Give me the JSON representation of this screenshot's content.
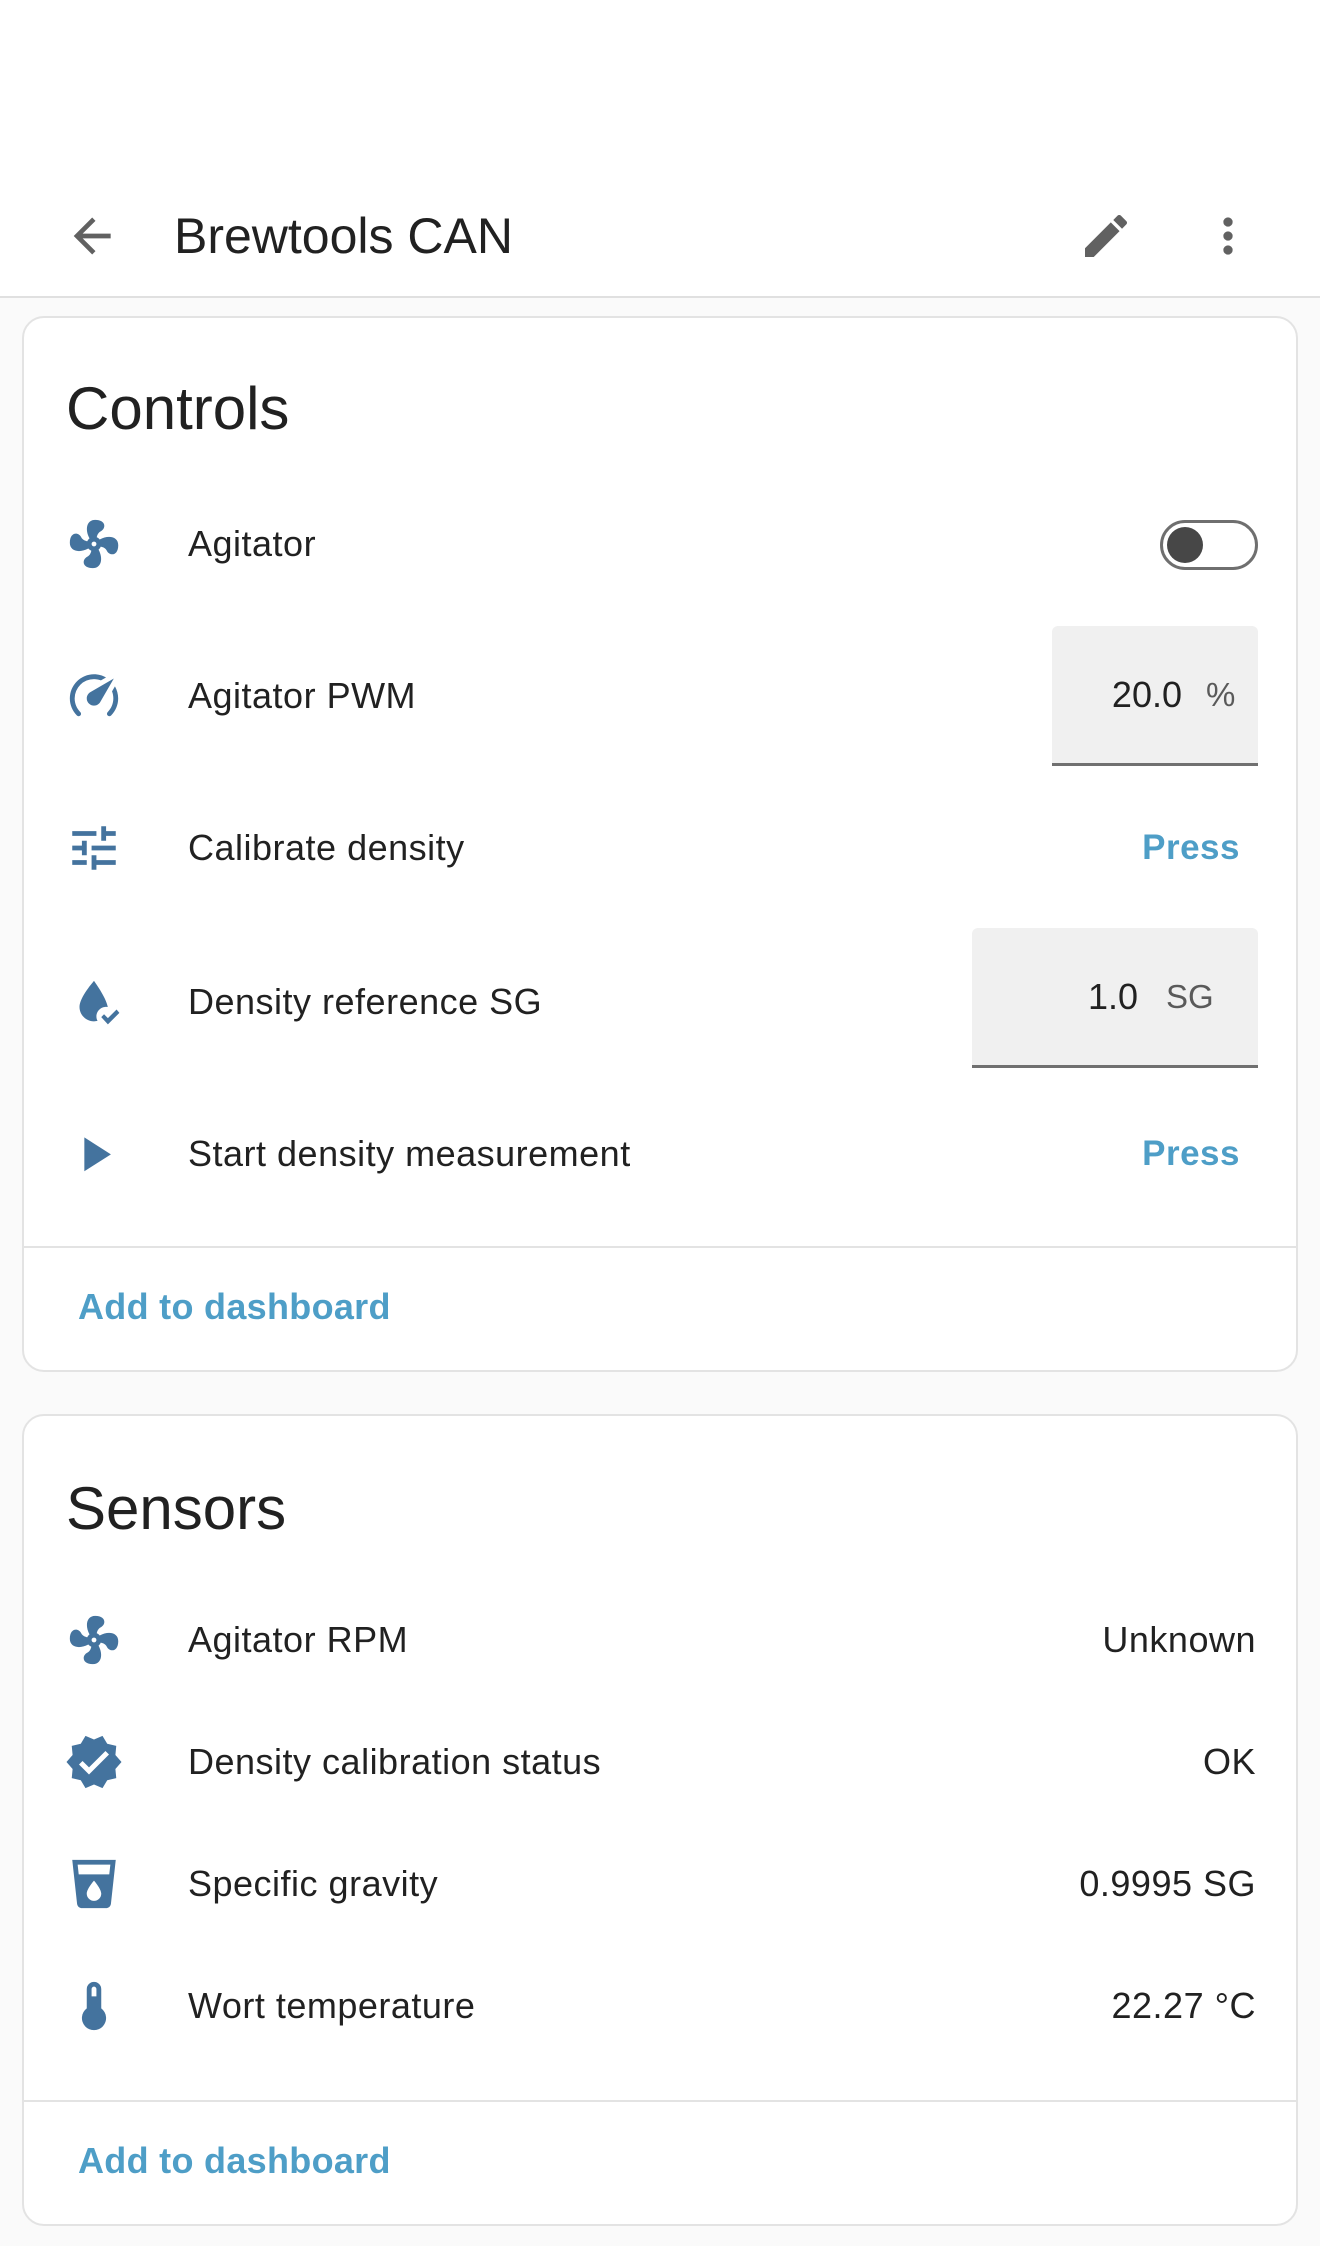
{
  "app_bar": {
    "title": "Brewtools CAN",
    "back_icon": "arrow-left-icon",
    "edit_icon": "pencil-icon",
    "more_icon": "dots-vertical-icon"
  },
  "accent_color": "#4e9ec7",
  "icon_color": "#44739e",
  "controls": {
    "title": "Controls",
    "agitator": {
      "label": "Agitator",
      "icon": "fan-icon",
      "state": "off"
    },
    "agitator_pwm": {
      "label": "Agitator PWM",
      "icon": "speedometer-icon",
      "value": "20.0",
      "unit": "%"
    },
    "calibrate_density": {
      "label": "Calibrate density",
      "icon": "tune-icon",
      "action": "Press"
    },
    "density_reference": {
      "label": "Density reference SG",
      "icon": "water-check-icon",
      "value": "1.0",
      "unit": "SG"
    },
    "start_measurement": {
      "label": "Start density measurement",
      "icon": "play-icon",
      "action": "Press"
    },
    "add_to_dashboard": "Add to dashboard"
  },
  "sensors": {
    "title": "Sensors",
    "items": [
      {
        "label": "Agitator RPM",
        "value": "Unknown",
        "icon": "fan-icon"
      },
      {
        "label": "Density calibration status",
        "value": "OK",
        "icon": "check-decagram-icon"
      },
      {
        "label": "Specific gravity",
        "value": "0.9995 SG",
        "icon": "cup-water-icon"
      },
      {
        "label": "Wort temperature",
        "value": "22.27 °C",
        "icon": "thermometer-icon"
      }
    ],
    "add_to_dashboard": "Add to dashboard"
  }
}
